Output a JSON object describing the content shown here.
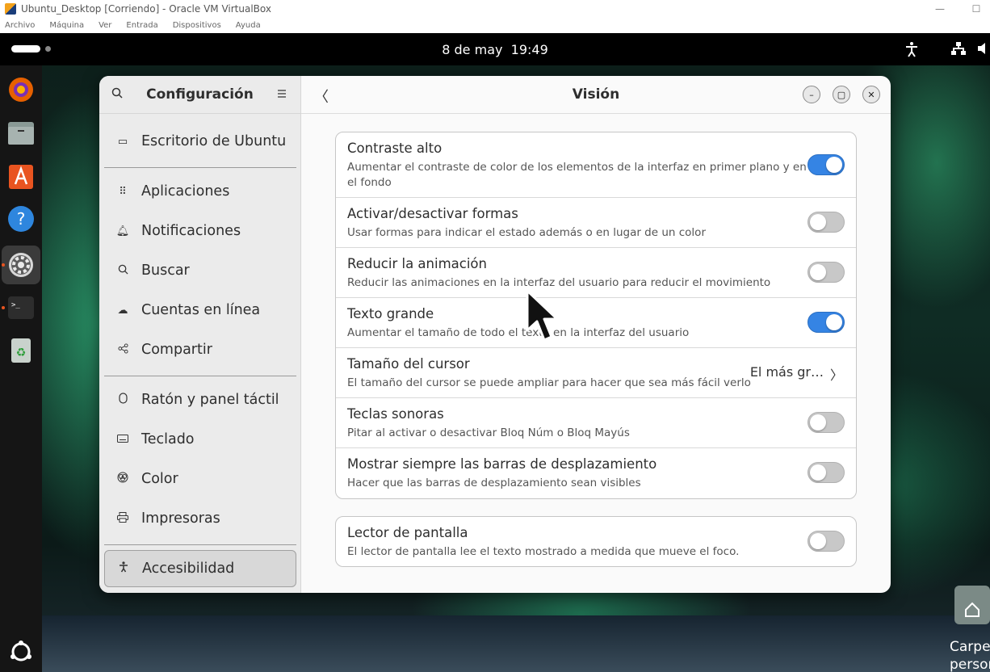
{
  "vbox": {
    "title": "Ubuntu_Desktop [Corriendo] - Oracle VM VirtualBox",
    "menu": [
      "Archivo",
      "Máquina",
      "Ver",
      "Entrada",
      "Dispositivos",
      "Ayuda"
    ]
  },
  "topbar": {
    "date": "8 de may",
    "time": "19:49"
  },
  "settings": {
    "sidebar_title": "Configuración",
    "items": [
      {
        "label": "Escritorio de Ubuntu",
        "icon": "desktop-icon"
      },
      {
        "label": "Aplicaciones",
        "icon": "grid-icon"
      },
      {
        "label": "Notificaciones",
        "icon": "bell-icon"
      },
      {
        "label": "Buscar",
        "icon": "search-icon"
      },
      {
        "label": "Cuentas en línea",
        "icon": "cloud-icon"
      },
      {
        "label": "Compartir",
        "icon": "share-icon"
      },
      {
        "label": "Ratón y panel táctil",
        "icon": "mouse-icon"
      },
      {
        "label": "Teclado",
        "icon": "keyboard-icon"
      },
      {
        "label": "Color",
        "icon": "color-icon"
      },
      {
        "label": "Impresoras",
        "icon": "printer-icon"
      },
      {
        "label": "Accesibilidad",
        "icon": "accessibility-icon",
        "selected": true
      }
    ],
    "page_title": "Visión",
    "rows": [
      {
        "title": "Contraste alto",
        "subtitle": "Aumentar el contraste de color de los elementos de la interfaz en primer plano y en el fondo",
        "enabled": true
      },
      {
        "title": "Activar/desactivar formas",
        "subtitle": "Usar formas para indicar el estado además o en lugar de un color",
        "enabled": false
      },
      {
        "title": "Reducir la animación",
        "subtitle": "Reducir las animaciones en la interfaz del usuario para reducir el movimiento",
        "enabled": false
      },
      {
        "title": "Texto grande",
        "subtitle": "Aumentar el tamaño de todo el texto en la interfaz del usuario",
        "enabled": true
      },
      {
        "title": "Tamaño del cursor",
        "subtitle": "El tamaño del cursor se puede ampliar para hacer que sea más fácil verlo",
        "value": "El más gr…"
      },
      {
        "title": "Teclas sonoras",
        "subtitle": "Pitar al activar o desactivar Bloq Núm o Bloq Mayús",
        "enabled": false
      },
      {
        "title": "Mostrar siempre las barras de desplazamiento",
        "subtitle": "Hacer que las barras de desplazamiento sean visibles",
        "enabled": false
      }
    ],
    "screen_reader": {
      "title": "Lector de pantalla",
      "subtitle": "El lector de pantalla lee el texto mostrado a medida que mueve el foco.",
      "enabled": false
    }
  },
  "desktop": {
    "home_label_line1": "Carpe",
    "home_label_line2": "persor"
  },
  "colors": {
    "accent": "#3584e4",
    "ubuntu_orange": "#e95420"
  }
}
